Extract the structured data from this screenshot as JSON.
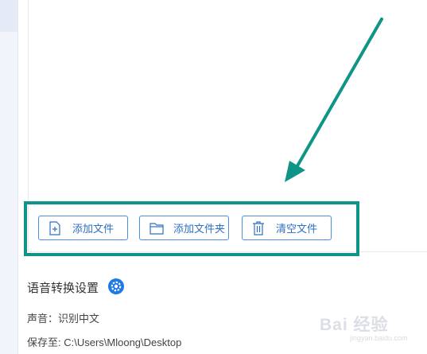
{
  "toolbar": {
    "add_file_label": "添加文件",
    "add_folder_label": "添加文件夹",
    "clear_label": "清空文件"
  },
  "settings": {
    "title": "语音转换设置",
    "voice_label": "声音：识别中文",
    "save_label": "保存至: C:\\Users\\Mloong\\Desktop"
  },
  "watermark": {
    "text": "Bai 经验",
    "sub": "jingyan.baidu.com"
  },
  "colors": {
    "annotation": "#0f9488",
    "button_accent": "#4a8fe0",
    "gear_icon": "#1e78e6"
  }
}
